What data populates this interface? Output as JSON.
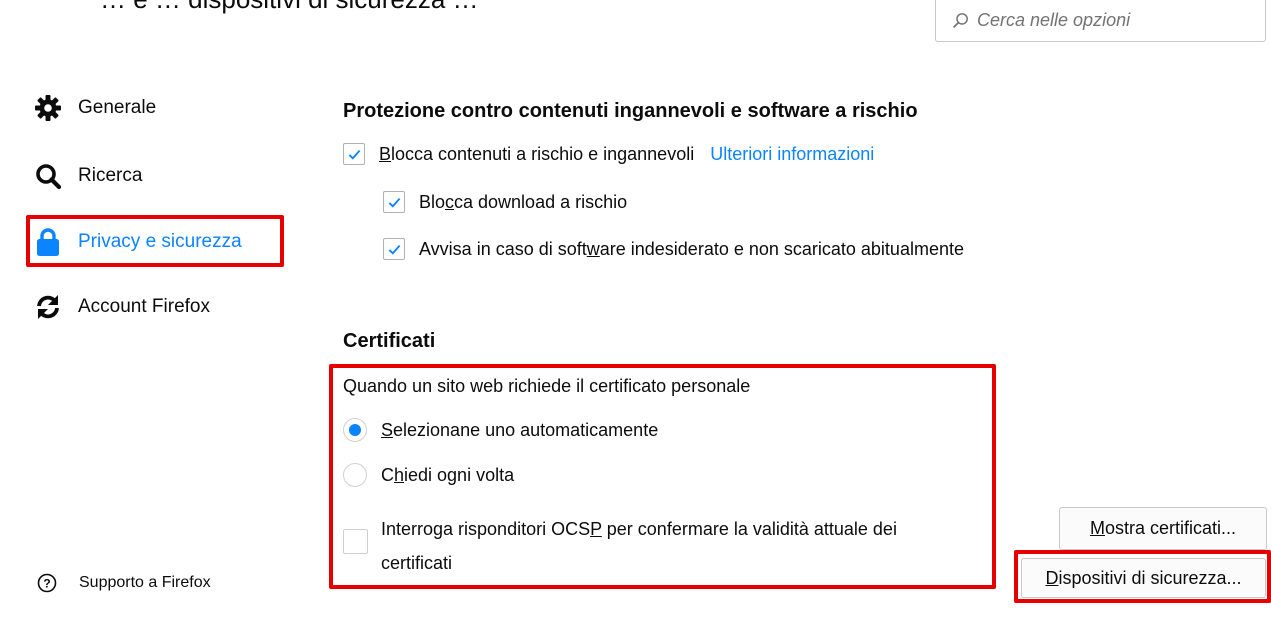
{
  "top_heading_partial": "… e … dispositivi di sicurezza …",
  "search": {
    "placeholder": "Cerca nelle opzioni"
  },
  "sidebar": {
    "items": [
      {
        "label": "Generale",
        "icon": "gear-icon"
      },
      {
        "label": "Ricerca",
        "icon": "search-icon"
      },
      {
        "label": "Privacy e sicurezza",
        "icon": "lock-icon",
        "active": true
      },
      {
        "label": "Account Firefox",
        "icon": "sync-icon"
      }
    ],
    "support_label": "Supporto a Firefox"
  },
  "protection": {
    "title": "Protezione contro contenuti ingannevoli e software a rischio",
    "block_dangerous": {
      "label_pre": "",
      "label_u": "B",
      "label_post": "locca contenuti a rischio e ingannevoli",
      "checked": true
    },
    "more_info_link": "Ulteriori informazioni",
    "block_downloads": {
      "label_pre": "Blo",
      "label_u": "c",
      "label_post": "ca download a rischio",
      "checked": true
    },
    "warn_unwanted": {
      "label_pre": "Avvisa in caso di soft",
      "label_u": "w",
      "label_post": "are indesiderato e non scaricato abitualmente",
      "checked": true
    }
  },
  "certificates": {
    "title": "Certificati",
    "prompt": "Quando un sito web richiede il certificato personale",
    "radio_auto": {
      "label_pre": "",
      "label_u": "S",
      "label_post": "elezionane uno automaticamente",
      "selected": true
    },
    "radio_ask": {
      "label_pre": "C",
      "label_u": "h",
      "label_post": "iedi ogni volta",
      "selected": false
    },
    "ocsp": {
      "line1_pre": "Interroga risponditori OCS",
      "line1_u": "P",
      "line1_post": " per confermare la validità attuale dei",
      "line2": "certificati",
      "checked": false
    },
    "view_certs_button": {
      "label_u": "M",
      "label_post": "ostra certificati..."
    },
    "security_devices_button": {
      "label_u": "D",
      "label_post": "ispositivi di sicurezza..."
    }
  },
  "colors": {
    "accent": "#0a84ff",
    "highlight": "#e60000",
    "text": "#0c0c0d"
  }
}
